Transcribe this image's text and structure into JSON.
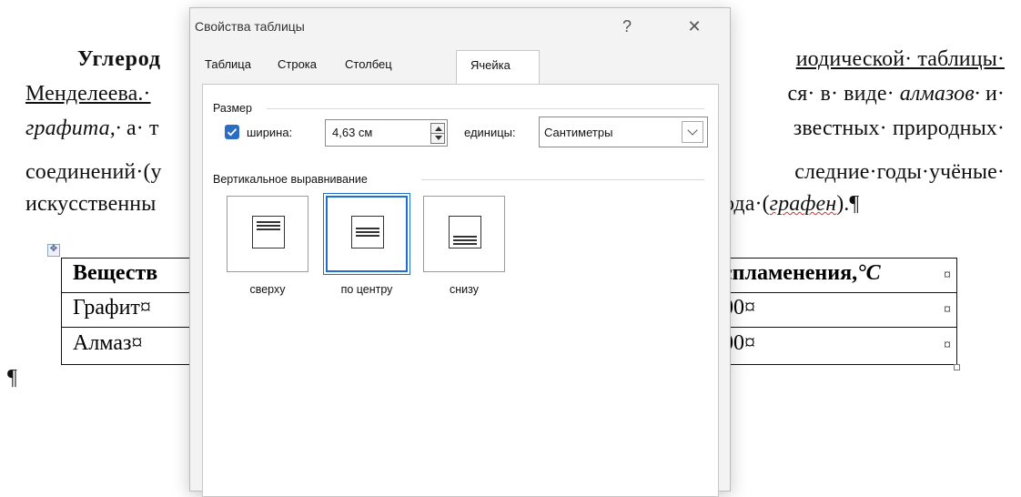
{
  "document": {
    "line1_bold": "Углерод",
    "line1_right": "иодической· таблицы·",
    "line2_left": "Менделеева.·",
    "line2_right": "ся· в· виде· алмазов· и·",
    "line2_right_a": "ся· в· виде·",
    "line2_right_i": "алмазов·",
    "line2_right_b": "и·",
    "line3_left_i": "графита,·",
    "line3_left_b": "а· т",
    "line3_right": "звестных· природных·",
    "line4_left": "соединений·(у",
    "line4_right": "следние·годы·учёные·",
    "line5_left": "искусственны",
    "line5_right_a": "ода·(",
    "line5_right_i": "графен",
    "line5_right_b": ").¶",
    "para_mark": "¶",
    "table": {
      "header_left": "Веществ",
      "header_right": "спламенения,",
      "header_unit": "°С",
      "header_mark": "¤",
      "rows": [
        {
          "left": "Графит¤",
          "right": "00¤",
          "mark": "¤"
        },
        {
          "left": "Алмаз¤",
          "right": "00¤",
          "mark": "¤"
        }
      ]
    }
  },
  "dialog": {
    "title": "Свойства таблицы",
    "help": "?",
    "close": "✕",
    "tabs": [
      {
        "label": "Таблица",
        "active": false
      },
      {
        "label": "Строка",
        "active": false
      },
      {
        "label": "Столбец",
        "active": false
      },
      {
        "label": "Ячейка",
        "active": true
      }
    ],
    "size_group": "Размер",
    "width_checked": true,
    "width_label": "ширина:",
    "width_value": "4,63 см",
    "units_label": "единицы:",
    "units_value": "Сантиметры",
    "valign_group": "Вертикальное выравнивание",
    "alignments": [
      {
        "label": "сверху",
        "selected": false
      },
      {
        "label": "по центру",
        "selected": true
      },
      {
        "label": "снизу",
        "selected": false
      }
    ],
    "accent": "#1d6fd1"
  }
}
